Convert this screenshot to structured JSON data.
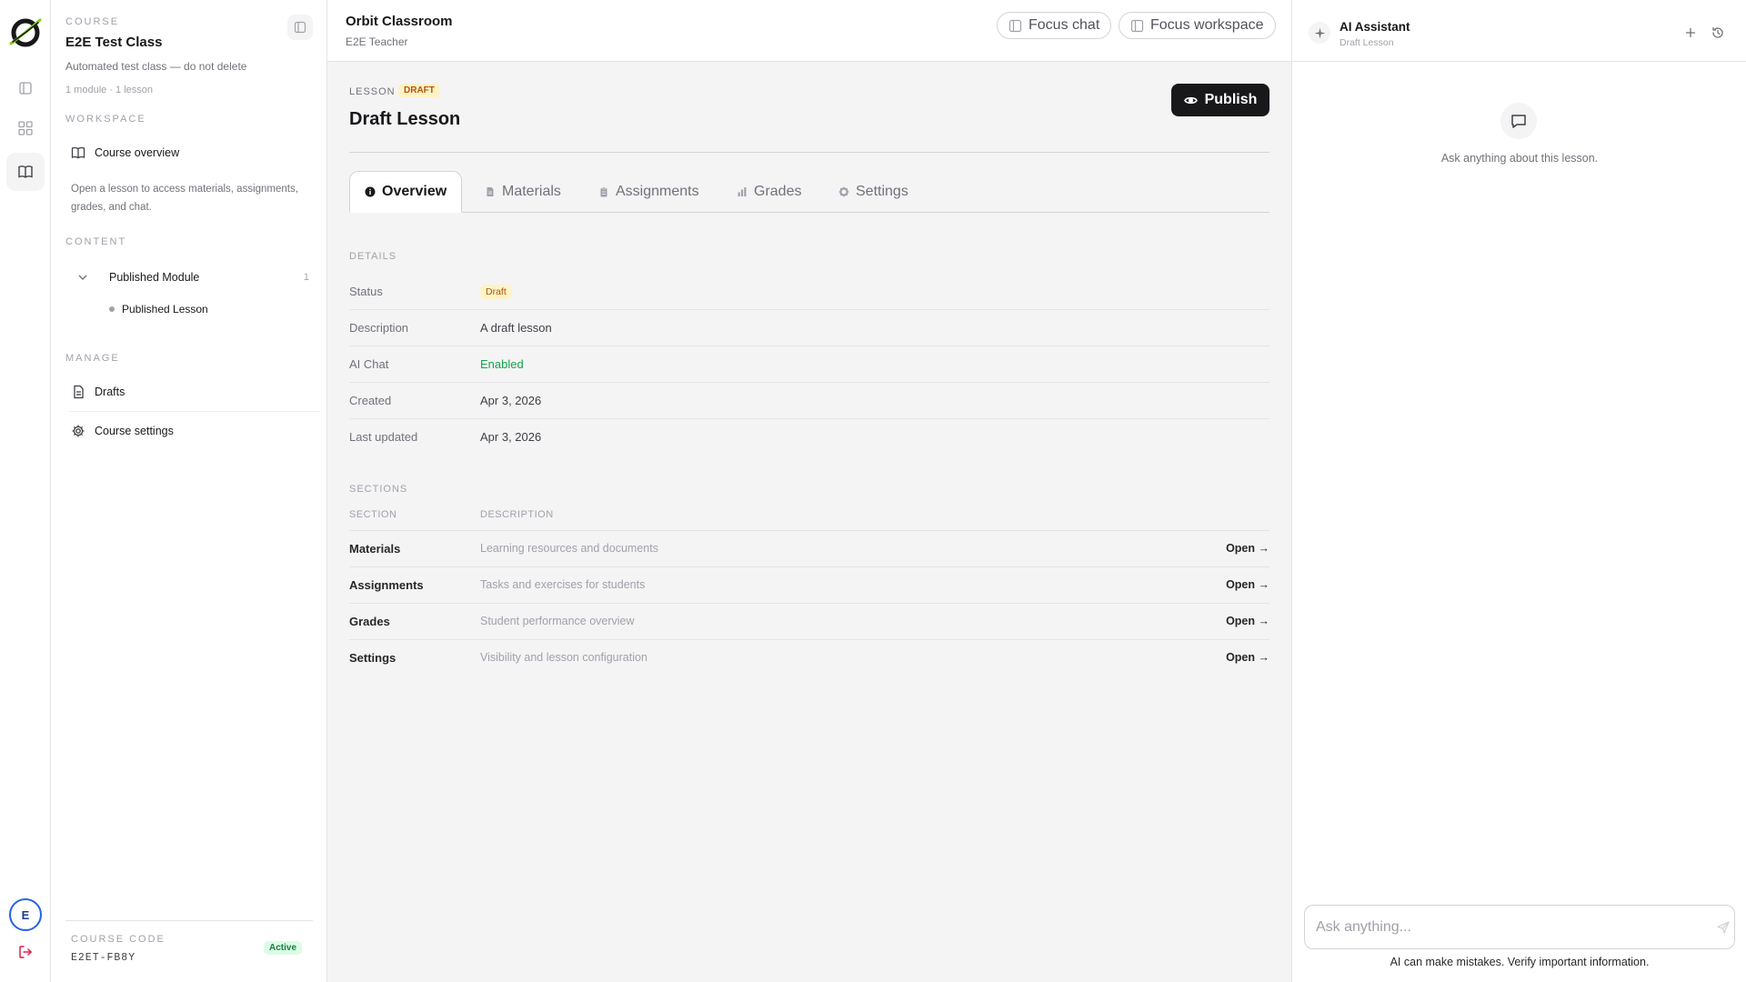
{
  "rail": {
    "avatar_initial": "E",
    "icons": [
      "logo-icon",
      "panel-icon",
      "grid-icon",
      "book-icon",
      "logout-icon"
    ]
  },
  "sidebar": {
    "course_label": "COURSE",
    "course_title": "E2E Test Class",
    "course_desc": "Automated test class — do not delete",
    "course_meta": "1 module · 1 lesson",
    "workspace_label": "WORKSPACE",
    "course_overview": "Course overview",
    "help_text": "Open a lesson to access materials, assignments, grades, and chat.",
    "content_label": "CONTENT",
    "module_name": "Published Module",
    "module_count": "1",
    "lesson_name": "Published Lesson",
    "manage_label": "MANAGE",
    "drafts": "Drafts",
    "course_settings": "Course settings",
    "code_label": "COURSE CODE",
    "code_value": "E2ET-FB8Y",
    "status_badge": "Active"
  },
  "topbar": {
    "app_title": "Orbit Classroom",
    "app_sub": "E2E Teacher",
    "focus_chat": "Focus chat",
    "focus_workspace": "Focus workspace"
  },
  "lesson": {
    "kicker": "LESSON",
    "draft_tag": "DRAFT",
    "title": "Draft Lesson",
    "publish": "Publish"
  },
  "tabs": [
    {
      "label": "Overview",
      "active": true
    },
    {
      "label": "Materials",
      "active": false
    },
    {
      "label": "Assignments",
      "active": false
    },
    {
      "label": "Grades",
      "active": false
    },
    {
      "label": "Settings",
      "active": false
    }
  ],
  "details": {
    "label": "DETAILS",
    "rows": [
      {
        "key": "Status",
        "value": "Draft"
      },
      {
        "key": "Description",
        "value": "A draft lesson"
      },
      {
        "key": "AI Chat",
        "value": "Enabled"
      },
      {
        "key": "Created",
        "value": "Apr 3, 2026"
      },
      {
        "key": "Last updated",
        "value": "Apr 3, 2026"
      }
    ]
  },
  "sections": {
    "label": "SECTIONS",
    "col_section": "SECTION",
    "col_description": "DESCRIPTION",
    "rows": [
      {
        "name": "Materials",
        "desc": "Learning resources and documents",
        "action": "Open →"
      },
      {
        "name": "Assignments",
        "desc": "Tasks and exercises for students",
        "action": "Open →"
      },
      {
        "name": "Grades",
        "desc": "Student performance overview",
        "action": "Open →"
      },
      {
        "name": "Settings",
        "desc": "Visibility and lesson configuration",
        "action": "Open →"
      }
    ]
  },
  "ai": {
    "title": "AI Assistant",
    "sub": "Draft Lesson",
    "empty_text": "Ask anything about this lesson.",
    "placeholder": "Ask anything...",
    "disclaimer": "AI can make mistakes. Verify important information."
  },
  "colors": {
    "accent_dark": "#18181b",
    "draft_bg": "#fef3c7",
    "draft_text": "#b45309",
    "enabled_green": "#16a34a",
    "active_bg": "#dcfce7",
    "logout_red": "#e11d48",
    "avatar_ring": "#2563eb"
  }
}
